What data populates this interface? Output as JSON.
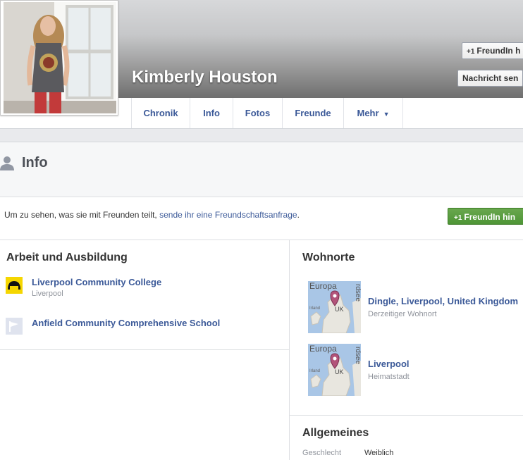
{
  "profile": {
    "name": "Kimberly Houston",
    "add_friend_label": "FreundIn h",
    "message_label": "Nachricht sen",
    "plus_glyph": "+1"
  },
  "nav": {
    "tabs": [
      {
        "label": "Chronik"
      },
      {
        "label": "Info"
      },
      {
        "label": "Fotos"
      },
      {
        "label": "Freunde"
      },
      {
        "label": "Mehr"
      }
    ]
  },
  "info": {
    "title": "Info",
    "notice_text": "Um zu sehen, was sie mit Freunden teilt, ",
    "notice_link": "sende ihr eine Freundschaftsanfrage",
    "notice_end": ".",
    "add_friend_button": "FreundIn hin"
  },
  "work": {
    "title": "Arbeit und Ausbildung",
    "items": [
      {
        "name": "Liverpool Community College",
        "sub": "Liverpool",
        "icon": "college-logo-icon"
      },
      {
        "name": "Anfield Community Comprehensive School",
        "sub": "",
        "icon": "school-flag-icon"
      }
    ]
  },
  "places": {
    "title": "Wohnorte",
    "items": [
      {
        "name": "Dingle, Liverpool, United Kingdom",
        "sub": "Derzeitiger Wohnort",
        "map_top_label": "Europa",
        "map_side_label": "rdsee",
        "map_left_label": "Irland",
        "map_country": "UK"
      },
      {
        "name": "Liverpool",
        "sub": "Heimatstadt",
        "map_top_label": "Europa",
        "map_side_label": "rdsee",
        "map_left_label": "Irland",
        "map_country": "UK"
      }
    ]
  },
  "general": {
    "title": "Allgemeines",
    "rows": [
      {
        "label": "Geschlecht",
        "value": "Weiblich"
      }
    ]
  },
  "colors": {
    "link": "#3b5998",
    "green_button": "#4e9536",
    "muted_text": "#90949c"
  }
}
